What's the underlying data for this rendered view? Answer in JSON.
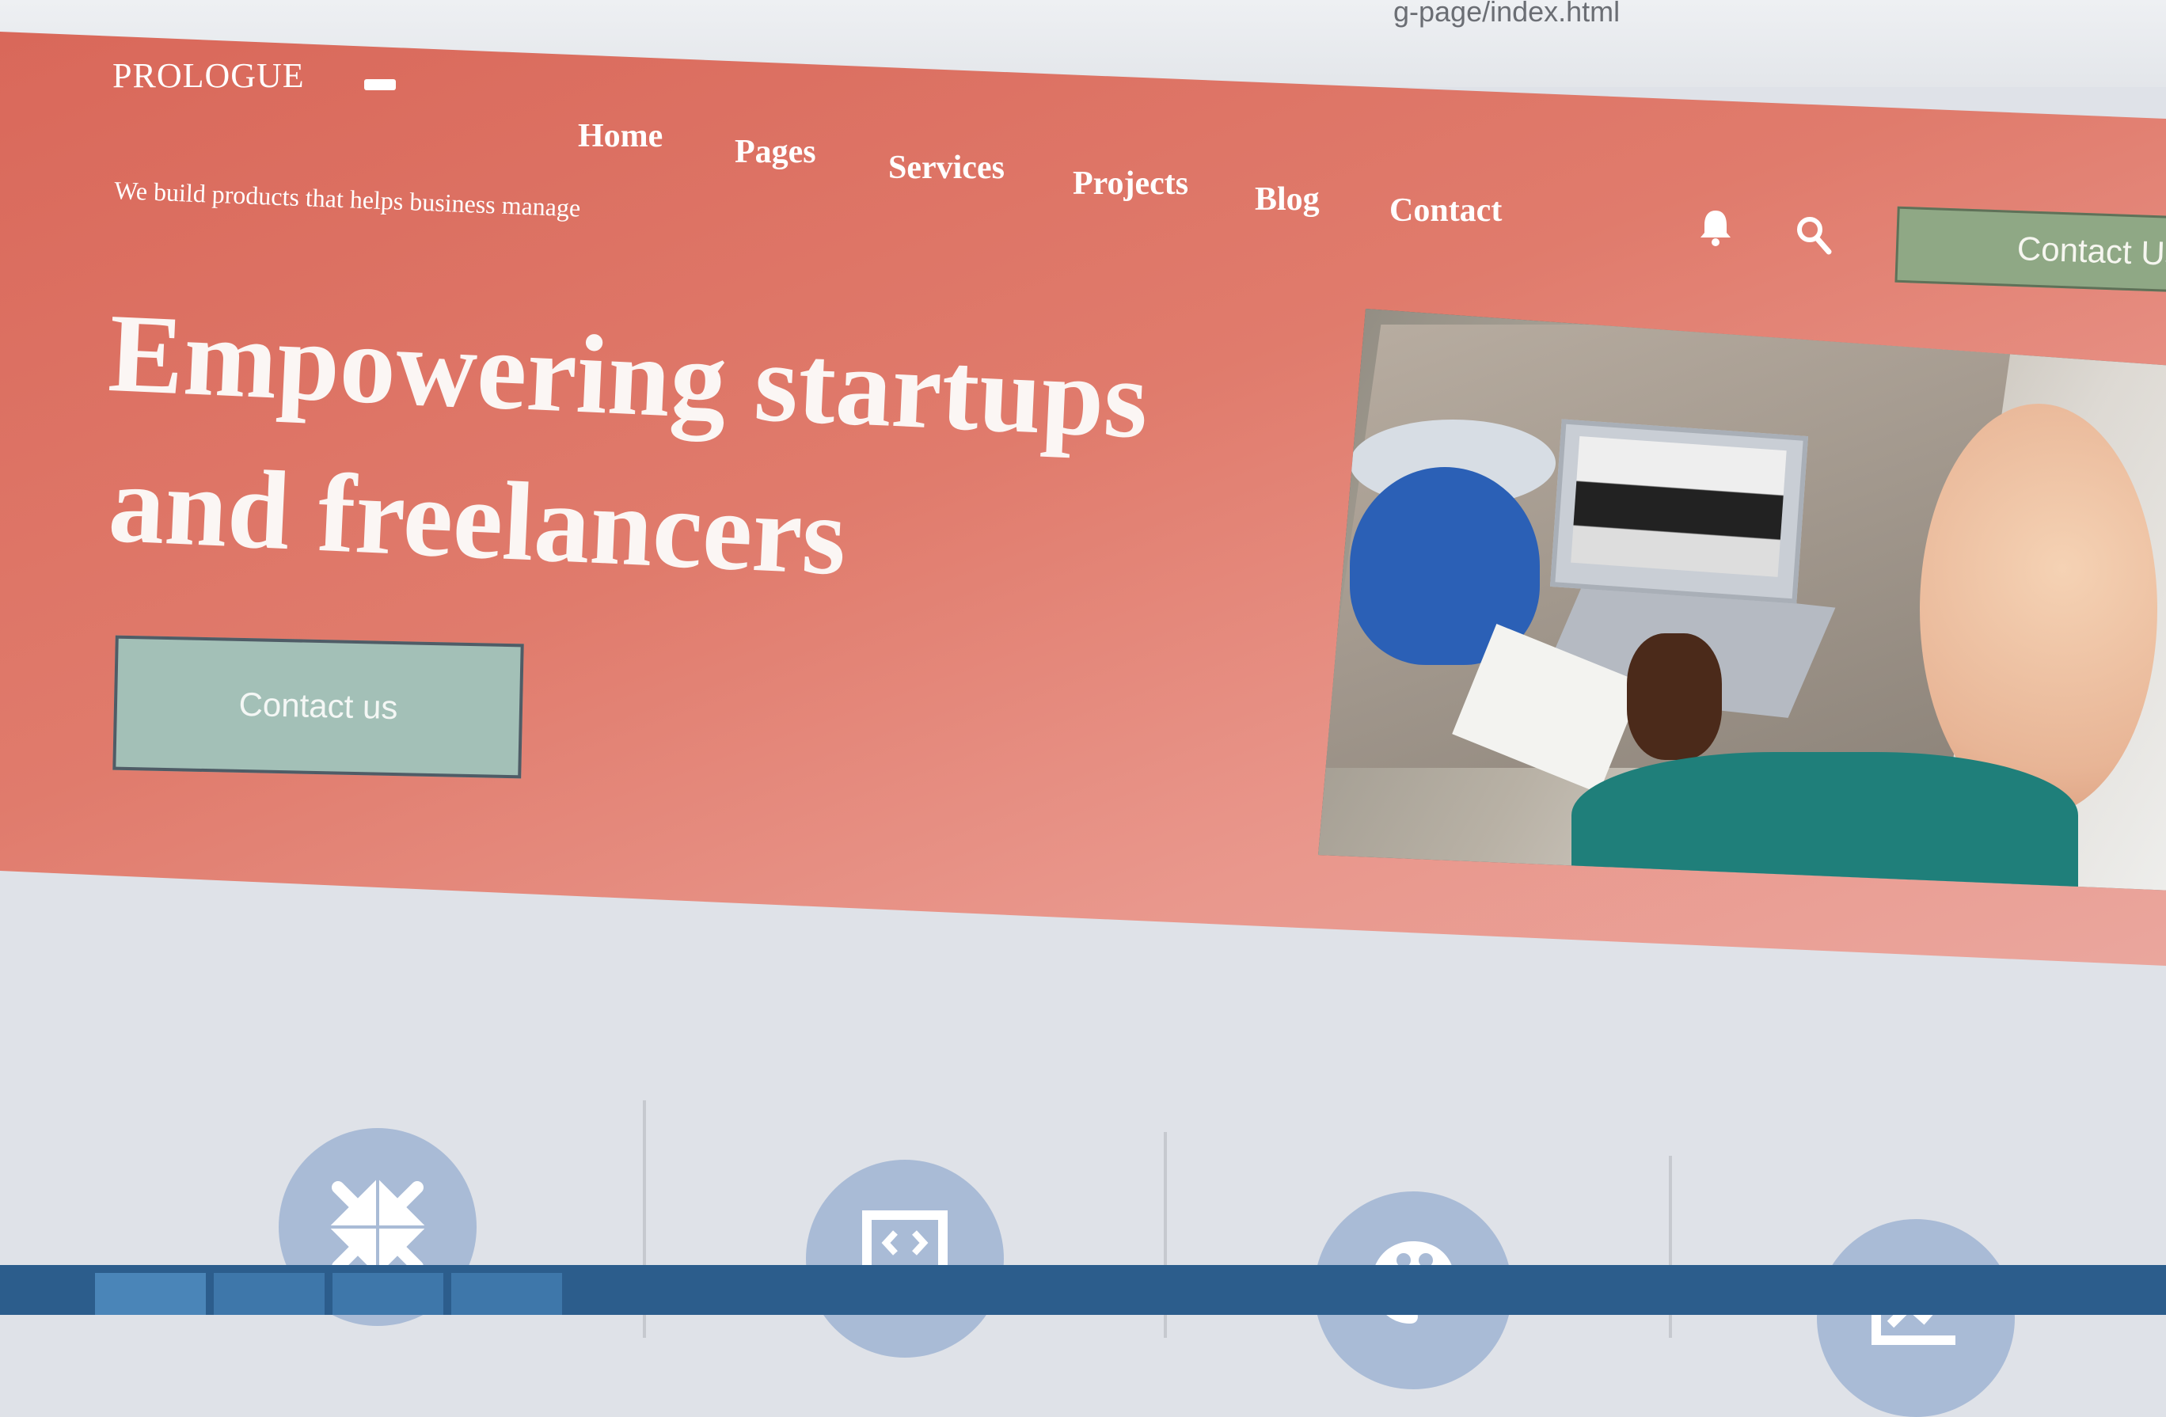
{
  "browser": {
    "url_fragment": "g-page/index.html"
  },
  "brand": {
    "logo": "PROLOGUE",
    "tagline": "We build products that helps business manage"
  },
  "nav": {
    "items": [
      "Home",
      "Pages",
      "Services",
      "Projects",
      "Blog",
      "Contact"
    ],
    "cta": "Contact Us",
    "icons": [
      "bell-icon",
      "search-icon"
    ]
  },
  "hero": {
    "headline_line1": "Empowering startups",
    "headline_line2_a": "and",
    "headline_line2_b": "freelancers",
    "button": "Contact us"
  },
  "features": {
    "icons": [
      "compress-arrows-icon",
      "laptop-code-icon",
      "palette-icon",
      "chart-icon"
    ]
  },
  "colors": {
    "hero_start": "#d9685a",
    "hero_end": "#eaa69d",
    "nav_cta": "#8fa885",
    "hero_cta": "#a3c0b7",
    "feature_icon": "#a9bbd6",
    "taskbar": "#2c5d8c"
  }
}
